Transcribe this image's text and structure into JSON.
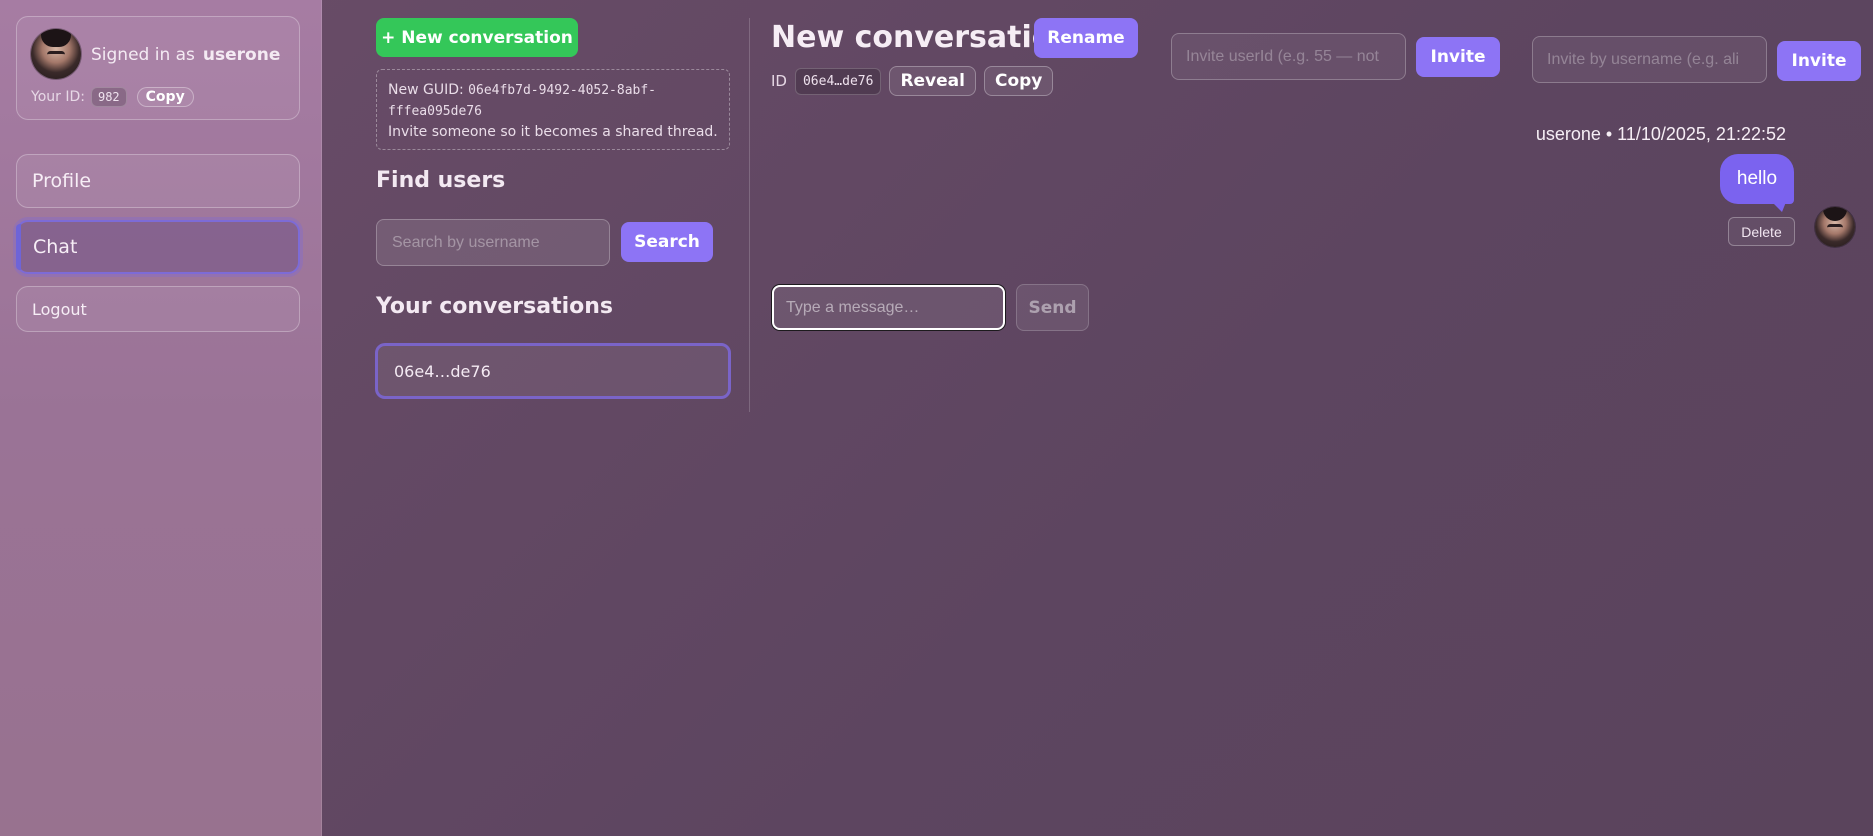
{
  "sidebar": {
    "signed_in_label": "Signed in as",
    "username": "userone",
    "your_id_label": "Your ID:",
    "user_id": "982",
    "copy_label": "Copy",
    "nav": {
      "profile": "Profile",
      "chat": "Chat",
      "logout": "Logout"
    }
  },
  "middle": {
    "new_conversation_label": "+ New conversation",
    "guid_prefix": "New GUID:",
    "guid_value": "06e4fb7d-9492-4052-8abf-fffea095de76",
    "guid_hint": "Invite someone so it becomes a shared thread.",
    "find_users_title": "Find users",
    "search_placeholder": "Search by username",
    "search_label": "Search",
    "conversations_title": "Your conversations",
    "conversations": [
      "06e4…de76"
    ]
  },
  "chat": {
    "title": "New conversation",
    "rename_label": "Rename",
    "id_label": "ID",
    "id_short": "06e4…de76",
    "reveal_label": "Reveal",
    "copy_label": "Copy",
    "invite_userid_placeholder": "Invite userId (e.g. 55 — not",
    "invite_username_placeholder": "Invite by username (e.g. ali",
    "invite_label": "Invite",
    "messages": [
      {
        "meta": "userone • 11/10/2025, 21:22:52",
        "text": "hello",
        "delete_label": "Delete"
      }
    ],
    "message_placeholder": "Type a message…",
    "send_label": "Send"
  },
  "colors": {
    "accent": "#8d74f5",
    "new_button": "#34c759",
    "bubble": "#7b63ef"
  }
}
